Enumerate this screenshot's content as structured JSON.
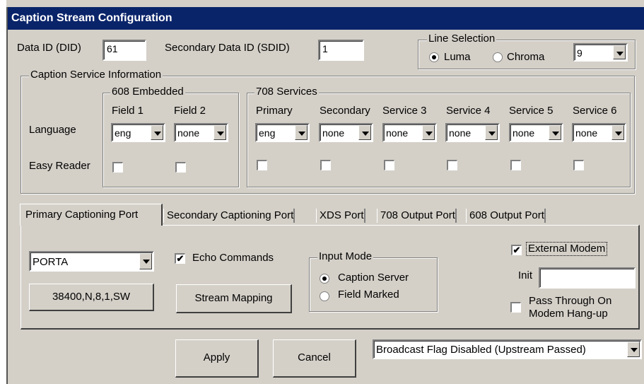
{
  "window": {
    "title": "Caption Stream Configuration"
  },
  "ids": {
    "did_label": "Data ID (DID)",
    "did_value": "61",
    "sdid_label": "Secondary Data ID (SDID)",
    "sdid_value": "1"
  },
  "line_selection": {
    "title": "Line Selection",
    "luma": "Luma",
    "chroma": "Chroma",
    "selected": "Luma",
    "line": "9"
  },
  "caption_service": {
    "title": "Caption Service Information",
    "row_language": "Language",
    "row_easy_reader": "Easy Reader",
    "embedded_608": {
      "title": "608 Embedded",
      "field1_label": "Field 1",
      "field1_value": "eng",
      "field2_label": "Field 2",
      "field2_value": "none"
    },
    "services_708": {
      "title": "708 Services",
      "primary": {
        "label": "Primary",
        "value": "eng"
      },
      "secondary": {
        "label": "Secondary",
        "value": "none"
      },
      "service3": {
        "label": "Service 3",
        "value": "none"
      },
      "service4": {
        "label": "Service 4",
        "value": "none"
      },
      "service5": {
        "label": "Service 5",
        "value": "none"
      },
      "service6": {
        "label": "Service 6",
        "value": "none"
      }
    }
  },
  "tabs": {
    "primary": "Primary Captioning Port",
    "secondary": "Secondary Captioning Port",
    "xds": "XDS Port",
    "output708": "708 Output Port",
    "output608": "608 Output Port",
    "active": "Primary Captioning Port"
  },
  "port": {
    "port_value": "PORTA",
    "settings_button": "38400,N,8,1,SW",
    "echo_label": "Echo Commands",
    "echo_checked": true,
    "mapping_button": "Stream Mapping",
    "input_mode": {
      "title": "Input Mode",
      "caption_server": "Caption Server",
      "field_marked": "Field Marked",
      "selected": "Caption Server"
    },
    "external_modem_label": "External Modem",
    "external_modem_checked": true,
    "init_label": "Init",
    "init_value": "",
    "pass_through_line1": "Pass Through On",
    "pass_through_line2": "Modem Hang-up",
    "pass_through_checked": false
  },
  "footer": {
    "apply": "Apply",
    "cancel": "Cancel",
    "broadcast_flag": "Broadcast Flag Disabled (Upstream Passed)"
  },
  "check_glyph": "✔"
}
